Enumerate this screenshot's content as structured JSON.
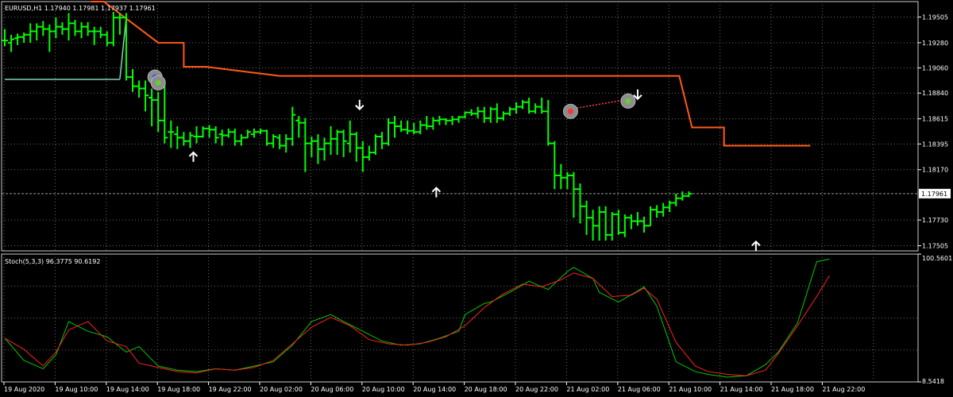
{
  "chart_data": [
    {
      "type": "line",
      "pane": "price",
      "title": "EURUSD,H1  1.17940 1.17981 1.17937 1.17961",
      "ylim": [
        1.1746,
        1.1964
      ],
      "yticks": [
        "1.19505",
        "1.19280",
        "1.19060",
        "1.18840",
        "1.18615",
        "1.18395",
        "1.18170",
        "1.17730",
        "1.17505"
      ],
      "current_price": "1.17961",
      "colors": {
        "bars": "#00ff00",
        "upper_line": "#ff5a1a",
        "lower_line": "#7fd6b0",
        "arrows": "#ffffff",
        "grid": "#6a6a6a",
        "axis": "#ffffff"
      },
      "bar_step_hours": 1,
      "series": [
        {
          "kind": "ohlc",
          "bars": [
            [
              1.193,
              1.194,
              1.1925,
              1.193
            ],
            [
              1.1928,
              1.1935,
              1.192,
              1.1931
            ],
            [
              1.1932,
              1.1936,
              1.1926,
              1.1933
            ],
            [
              1.1933,
              1.1937,
              1.1928,
              1.1935
            ],
            [
              1.1935,
              1.1945,
              1.1928,
              1.1938
            ],
            [
              1.1938,
              1.1945,
              1.193,
              1.1942
            ],
            [
              1.1942,
              1.1947,
              1.1934,
              1.194
            ],
            [
              1.194,
              1.1944,
              1.192,
              1.1938
            ],
            [
              1.1938,
              1.195,
              1.1932,
              1.1942
            ],
            [
              1.1942,
              1.1946,
              1.1935,
              1.194
            ],
            [
              1.194,
              1.1954,
              1.193,
              1.1945
            ],
            [
              1.1945,
              1.1948,
              1.1934,
              1.1938
            ],
            [
              1.1938,
              1.1946,
              1.1932,
              1.1942
            ],
            [
              1.1942,
              1.1946,
              1.1934,
              1.1938
            ],
            [
              1.1938,
              1.1942,
              1.1926,
              1.1938
            ],
            [
              1.1938,
              1.1942,
              1.1932,
              1.1935
            ],
            [
              1.1935,
              1.1938,
              1.1925,
              1.1928
            ],
            [
              1.1928,
              1.1955,
              1.1925,
              1.195
            ],
            [
              1.195,
              1.1954,
              1.1935,
              1.195
            ],
            [
              1.195,
              1.1954,
              1.1895,
              1.1898
            ],
            [
              1.1898,
              1.1905,
              1.1885,
              1.189
            ],
            [
              1.189,
              1.1895,
              1.188,
              1.1888
            ],
            [
              1.1888,
              1.1895,
              1.1868,
              1.1882
            ],
            [
              1.188,
              1.1888,
              1.1855,
              1.1878
            ],
            [
              1.1878,
              1.1885,
              1.185,
              1.186
            ],
            [
              1.186,
              1.1892,
              1.184,
              1.1845
            ],
            [
              1.185,
              1.186,
              1.1836,
              1.185
            ],
            [
              1.1848,
              1.1855,
              1.1835,
              1.1845
            ],
            [
              1.1845,
              1.185,
              1.1838,
              1.1842
            ],
            [
              1.1842,
              1.185,
              1.1836,
              1.1847
            ],
            [
              1.1846,
              1.1855,
              1.184,
              1.1846
            ],
            [
              1.1846,
              1.1855,
              1.1845,
              1.1853
            ],
            [
              1.1853,
              1.1856,
              1.1845,
              1.1852
            ],
            [
              1.1852,
              1.1855,
              1.184,
              1.1845
            ],
            [
              1.1848,
              1.1852,
              1.1838,
              1.1847
            ],
            [
              1.1847,
              1.1853,
              1.1845,
              1.185
            ],
            [
              1.185,
              1.1853,
              1.1838,
              1.1842
            ],
            [
              1.1842,
              1.1848,
              1.1838,
              1.1845
            ],
            [
              1.1845,
              1.1852,
              1.1845,
              1.185
            ],
            [
              1.1848,
              1.1853,
              1.1845,
              1.185
            ],
            [
              1.185,
              1.1853,
              1.1848,
              1.1851
            ],
            [
              1.1851,
              1.1852,
              1.1838,
              1.184
            ],
            [
              1.184,
              1.1848,
              1.1836,
              1.1846
            ],
            [
              1.1845,
              1.1848,
              1.1835,
              1.1838
            ],
            [
              1.1838,
              1.1848,
              1.1832,
              1.1844
            ],
            [
              1.1844,
              1.1872,
              1.1838,
              1.1865
            ],
            [
              1.186,
              1.1864,
              1.1845,
              1.1858
            ],
            [
              1.1858,
              1.1862,
              1.1815,
              1.184
            ],
            [
              1.184,
              1.1846,
              1.1828,
              1.1842
            ],
            [
              1.1842,
              1.1848,
              1.1822,
              1.1835
            ],
            [
              1.1835,
              1.1845,
              1.1825,
              1.184
            ],
            [
              1.184,
              1.1855,
              1.183,
              1.1844
            ],
            [
              1.1844,
              1.1852,
              1.183,
              1.185
            ],
            [
              1.185,
              1.1852,
              1.1828,
              1.1842
            ],
            [
              1.184,
              1.186,
              1.1832,
              1.1848
            ],
            [
              1.1848,
              1.185,
              1.1824,
              1.1836
            ],
            [
              1.1836,
              1.1842,
              1.1815,
              1.1828
            ],
            [
              1.1828,
              1.1838,
              1.1825,
              1.1832
            ],
            [
              1.1832,
              1.1848,
              1.183,
              1.1846
            ],
            [
              1.1846,
              1.185,
              1.1835,
              1.184
            ],
            [
              1.184,
              1.1862,
              1.1838,
              1.1858
            ],
            [
              1.1858,
              1.1864,
              1.1845,
              1.1855
            ],
            [
              1.1855,
              1.186,
              1.185,
              1.1852
            ],
            [
              1.1852,
              1.186,
              1.1848,
              1.1851
            ],
            [
              1.1851,
              1.1858,
              1.1848,
              1.185
            ],
            [
              1.185,
              1.186,
              1.1848,
              1.1856
            ],
            [
              1.1856,
              1.1864,
              1.1852,
              1.1855
            ],
            [
              1.1855,
              1.1863,
              1.1852,
              1.186
            ],
            [
              1.186,
              1.1864,
              1.1856,
              1.1861
            ],
            [
              1.1861,
              1.1862,
              1.1856,
              1.186
            ],
            [
              1.186,
              1.1864,
              1.1856,
              1.1861
            ],
            [
              1.1861,
              1.1864,
              1.1858,
              1.1863
            ],
            [
              1.1863,
              1.1868,
              1.1862,
              1.1867
            ],
            [
              1.1867,
              1.187,
              1.1864,
              1.1866
            ],
            [
              1.1866,
              1.1872,
              1.1862,
              1.1868
            ],
            [
              1.1868,
              1.1872,
              1.1858,
              1.1862
            ],
            [
              1.1862,
              1.1872,
              1.1858,
              1.187
            ],
            [
              1.187,
              1.1875,
              1.1858,
              1.1862
            ],
            [
              1.1862,
              1.1868,
              1.186,
              1.1866
            ],
            [
              1.1866,
              1.1872,
              1.1864,
              1.187
            ],
            [
              1.187,
              1.1876,
              1.1866,
              1.1872
            ],
            [
              1.1872,
              1.1878,
              1.187,
              1.1876
            ],
            [
              1.1876,
              1.188,
              1.1866,
              1.1868
            ],
            [
              1.1868,
              1.1875,
              1.1866,
              1.1872
            ],
            [
              1.1872,
              1.188,
              1.1866,
              1.1868
            ],
            [
              1.1868,
              1.1878,
              1.1838,
              1.184
            ],
            [
              1.184,
              1.1842,
              1.18,
              1.1812
            ],
            [
              1.1812,
              1.1822,
              1.18,
              1.181
            ],
            [
              1.181,
              1.1815,
              1.18,
              1.1812
            ],
            [
              1.1812,
              1.1815,
              1.1775,
              1.18
            ],
            [
              1.18,
              1.1805,
              1.177,
              1.1785
            ],
            [
              1.1785,
              1.179,
              1.176,
              1.1775
            ],
            [
              1.1775,
              1.1782,
              1.1755,
              1.1768
            ],
            [
              1.1768,
              1.1785,
              1.1755,
              1.178
            ],
            [
              1.178,
              1.1785,
              1.1755,
              1.176
            ],
            [
              1.176,
              1.178,
              1.1755,
              1.1778
            ],
            [
              1.1778,
              1.1782,
              1.176,
              1.1762
            ],
            [
              1.1762,
              1.1778,
              1.1758,
              1.1775
            ],
            [
              1.1775,
              1.1778,
              1.1765,
              1.1772
            ],
            [
              1.1772,
              1.178,
              1.1768,
              1.1772
            ],
            [
              1.1772,
              1.1776,
              1.1762,
              1.1768
            ],
            [
              1.1768,
              1.1785,
              1.1768,
              1.1782
            ],
            [
              1.1782,
              1.1786,
              1.1775,
              1.178
            ],
            [
              1.178,
              1.1788,
              1.1776,
              1.1784
            ],
            [
              1.1784,
              1.179,
              1.178,
              1.1788
            ],
            [
              1.1788,
              1.1796,
              1.1785,
              1.1792
            ],
            [
              1.1792,
              1.1798,
              1.179,
              1.1794
            ],
            [
              1.1794,
              1.1798,
              1.1793,
              1.1796
            ]
          ]
        },
        {
          "kind": "line",
          "role": "upper",
          "x": [
            13.5,
            14.5,
            15.5,
            24,
            24,
            28,
            28,
            31.5,
            31.5,
            43,
            43,
            105.5,
            105.5,
            107.5,
            107.5,
            112.5,
            112.5,
            115.5,
            115.5,
            126
          ],
          "y": [
            1.1966,
            1.1966,
            1.1966,
            1.1928,
            1.1928,
            1.1928,
            1.1907,
            1.1907,
            1.1907,
            1.1899,
            1.1899,
            1.1899,
            1.1899,
            1.1854,
            1.1854,
            1.1854,
            1.1838,
            1.1838,
            1.1838,
            1.1838
          ]
        },
        {
          "kind": "line",
          "role": "lower",
          "x": [
            0,
            18
          ],
          "y": [
            1.1896,
            1.1896
          ]
        },
        {
          "kind": "line",
          "role": "lower-connector",
          "x": [
            18,
            19
          ],
          "y": [
            1.1896,
            1.195
          ]
        },
        {
          "kind": "line",
          "role": "trade-link",
          "x": [
            88.5,
            97
          ],
          "y": [
            1.187,
            1.1878
          ]
        }
      ],
      "arrows": [
        {
          "dir": "up",
          "x": 29.5,
          "y": 1.1828
        },
        {
          "dir": "down",
          "x": 55.5,
          "y": 1.1874
        },
        {
          "dir": "up",
          "x": 67.5,
          "y": 1.1797
        },
        {
          "dir": "down",
          "x": 99,
          "y": 1.1883
        },
        {
          "dir": "up",
          "x": 117.5,
          "y": 1.175
        }
      ],
      "trade_markers": [
        {
          "x": 23.5,
          "y": 1.1898,
          "color": "#3355ff"
        },
        {
          "x": 24,
          "y": 1.1893,
          "color": "#66cc33"
        },
        {
          "x": 88.5,
          "y": 1.1868,
          "color": "#ff3333"
        },
        {
          "x": 97.5,
          "y": 1.1877,
          "color": "#66cc33"
        }
      ]
    },
    {
      "type": "line",
      "pane": "oscillator",
      "title": "Stoch(5,3,3) 96.3775 90.6192",
      "ylim": [
        8.5418,
        100.5601
      ],
      "yticks": [
        "100.5601",
        "8.5418"
      ],
      "colors": {
        "main": "#00cc00",
        "signal": "#ff2222"
      },
      "xticks": [
        "19 Aug 2020",
        "19 Aug 10:00",
        "19 Aug 14:00",
        "19 Aug 18:00",
        "19 Aug 22:00",
        "20 Aug 02:00",
        "20 Aug 06:00",
        "20 Aug 10:00",
        "20 Aug 14:00",
        "20 Aug 18:00",
        "20 Aug 22:00",
        "21 Aug 02:00",
        "21 Aug 06:00",
        "21 Aug 10:00",
        "21 Aug 14:00",
        "21 Aug 18:00",
        "21 Aug 22:00"
      ],
      "series": [
        {
          "role": "main",
          "x": [
            0,
            3,
            6,
            8,
            10,
            13,
            16,
            19,
            21,
            24,
            27,
            30,
            33,
            36,
            39,
            42,
            45,
            48,
            51,
            53,
            56,
            59,
            62,
            65,
            68,
            71,
            72,
            75,
            76,
            79,
            82,
            85,
            88,
            89,
            92,
            93,
            96,
            99,
            100,
            102,
            105,
            108,
            110,
            113,
            116,
            119,
            121,
            124,
            127,
            129
          ],
          "y": [
            40,
            24,
            18,
            28,
            52,
            45,
            41,
            30,
            34,
            20,
            17,
            16,
            18,
            17,
            20,
            23,
            35,
            52,
            57,
            52,
            45,
            38,
            35,
            36,
            40,
            45,
            57,
            65,
            66,
            73,
            81,
            75,
            88,
            91,
            83,
            73,
            66,
            74,
            77,
            63,
            23,
            16,
            14,
            12,
            13,
            21,
            30,
            51,
            95,
            97
          ]
        },
        {
          "role": "signal",
          "x": [
            0,
            3,
            6,
            8,
            10,
            13,
            16,
            19,
            21,
            24,
            27,
            30,
            33,
            36,
            39,
            42,
            45,
            48,
            51,
            54,
            57,
            60,
            63,
            66,
            69,
            72,
            75,
            78,
            81,
            84,
            87,
            89,
            92,
            95,
            98,
            100,
            102,
            105,
            108,
            110,
            113,
            116,
            119,
            121,
            124,
            127,
            129
          ],
          "y": [
            40,
            32,
            20,
            30,
            46,
            52,
            38,
            34,
            22,
            19,
            16,
            15,
            18,
            17,
            19,
            24,
            36,
            48,
            55,
            49,
            39,
            36,
            35,
            37,
            41,
            49,
            62,
            72,
            79,
            77,
            82,
            87,
            83,
            70,
            71,
            76,
            68,
            37,
            20,
            16,
            14,
            13,
            17,
            29,
            49,
            70,
            85
          ]
        }
      ]
    }
  ]
}
